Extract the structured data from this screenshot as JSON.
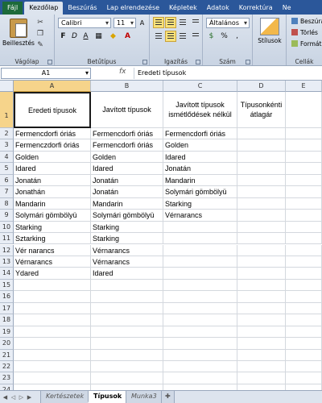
{
  "ribbon": {
    "tabs": [
      "Fájl",
      "Kezdőlap",
      "Beszúrás",
      "Lap elrendezése",
      "Képletek",
      "Adatok",
      "Korrektúra",
      "Ne"
    ],
    "active_tab": "Kezdőlap",
    "paste_label": "Beillesztés",
    "groups": {
      "clipboard": "Vágólap",
      "font": "Betűtípus",
      "alignment": "Igazítás",
      "number": "Szám",
      "styles": "Stílusok",
      "cells": "Cellák"
    },
    "font_name": "Calibri",
    "font_size": "11",
    "number_format": "Általános",
    "styles_label": "Stílusok",
    "cell_commands": [
      "Beszúrás",
      "Törlés",
      "Formátum"
    ]
  },
  "formula_bar": {
    "name_box": "A1",
    "fx": "fx",
    "content": "Eredeti típusok"
  },
  "sheet": {
    "columns": [
      "A",
      "B",
      "C",
      "D",
      "E"
    ],
    "rows": [
      "1",
      "2",
      "3",
      "4",
      "5",
      "6",
      "7",
      "8",
      "9",
      "10",
      "11",
      "12",
      "13",
      "14",
      "15",
      "16",
      "17",
      "18",
      "19",
      "20",
      "21",
      "22",
      "23",
      "24"
    ],
    "headers": [
      "Eredeti típusok",
      "Javított típusok",
      "Javított típusok ismétlődések nélkül",
      "Típusonkénti átlagár",
      ""
    ],
    "col_a": [
      "Fermencdorfi óriás",
      "Fermenczdorfi óriás",
      "Golden",
      "Idared",
      "Jonatán",
      "Jonathán",
      "Mandarin",
      "Solymári gömbölyü",
      "Starking",
      "Sztarking",
      "Vér narancs",
      "Vérnarancs",
      "Ydared"
    ],
    "col_b": [
      "Fermencdorfi óriás",
      "Fermencdorfi óriás",
      "Golden",
      "Idared",
      "Jonatán",
      "Jonatán",
      "Mandarin",
      "Solymári gömbölyü",
      "Starking",
      "Starking",
      "Vérnarancs",
      "Vérnarancs",
      "Idared"
    ],
    "col_c": [
      "Fermencdorfi óriás",
      "Golden",
      "Idared",
      "Jonatán",
      "Mandarin",
      "Solymári gömbölyü",
      "Starking",
      "Vérnarancs"
    ]
  },
  "sheet_tabs": {
    "tabs": [
      "Kertészetek",
      "Típusok",
      "Munka3"
    ],
    "active": "Típusok"
  },
  "colors": {
    "ribbon_blue": "#2b579a",
    "file_tab_green": "#1d6a3a",
    "selection_header": "#f6d48b",
    "grid_line": "#d4d8de"
  }
}
